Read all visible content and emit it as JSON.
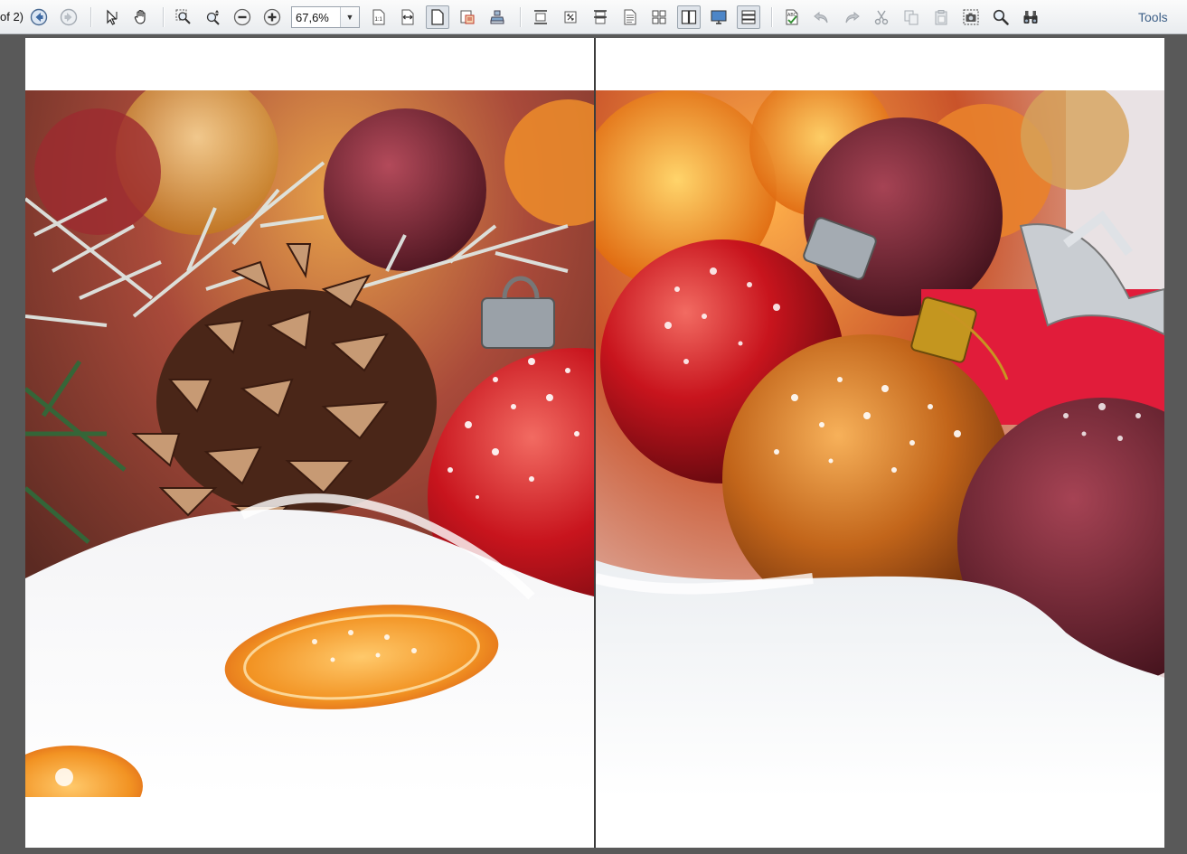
{
  "toolbar": {
    "page_of": "of 2)",
    "zoom": {
      "value": "67,6%",
      "options": [
        "67,6%"
      ]
    },
    "tools_label": "Tools",
    "buttons": [
      {
        "name": "previous-page-icon"
      },
      {
        "name": "next-page-icon"
      },
      {
        "name": "select-tool-icon"
      },
      {
        "name": "hand-tool-icon"
      },
      {
        "name": "marquee-zoom-icon"
      },
      {
        "name": "dynamic-zoom-icon"
      },
      {
        "name": "zoom-out-icon"
      },
      {
        "name": "zoom-in-icon"
      },
      {
        "name": "actual-size-icon"
      },
      {
        "name": "fit-width-icon"
      },
      {
        "name": "fit-page-icon"
      },
      {
        "name": "rotate-icon"
      },
      {
        "name": "stamp-icon"
      },
      {
        "name": "single-page-icon"
      },
      {
        "name": "continuous-icon"
      },
      {
        "name": "facing-icon"
      },
      {
        "name": "page-icon"
      },
      {
        "name": "grid-icon"
      },
      {
        "name": "two-page-icon"
      },
      {
        "name": "fullscreen-icon"
      },
      {
        "name": "scroll-mode-icon"
      },
      {
        "name": "spellcheck-icon"
      },
      {
        "name": "undo-icon"
      },
      {
        "name": "redo-icon"
      },
      {
        "name": "cut-icon"
      },
      {
        "name": "copy-icon"
      },
      {
        "name": "paste-icon"
      },
      {
        "name": "snapshot-icon"
      },
      {
        "name": "search-icon"
      },
      {
        "name": "find-binoculars-icon"
      }
    ]
  },
  "document": {
    "spread": "two-page",
    "image_subject": "christmas-ornaments"
  },
  "colors": {
    "toolbar_bg": "#eef0f2",
    "workspace_bg": "#595959",
    "accent": "#3d5f87"
  }
}
